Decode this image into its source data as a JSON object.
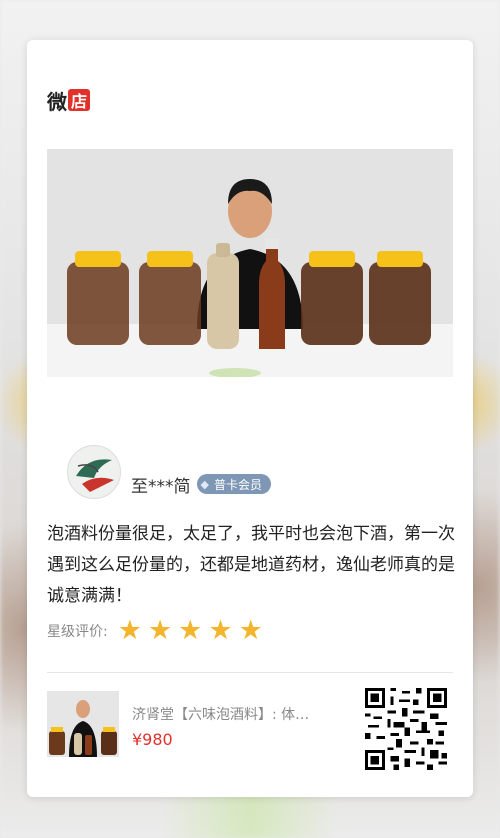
{
  "brand": {
    "part1": "微",
    "part2": "店"
  },
  "review": {
    "reviewer_name": "至***简",
    "member_badge": "普卡会员",
    "text": "泡酒料份量很足，太足了，我平时也会泡下酒，第一次遇到这么足份量的，还都是地道药材，逸仙老师真的是诚意满满！",
    "rating_label": "星级评价:",
    "stars": 5
  },
  "product": {
    "title": "济肾堂【六味泡酒料】: 体…",
    "price": "¥980"
  },
  "icons": [
    "diamond-icon",
    "star-icon",
    "qr-code"
  ],
  "colors": {
    "brand_red": "#e0322b",
    "star": "#f4b52e",
    "badge": "#7e97b5"
  }
}
